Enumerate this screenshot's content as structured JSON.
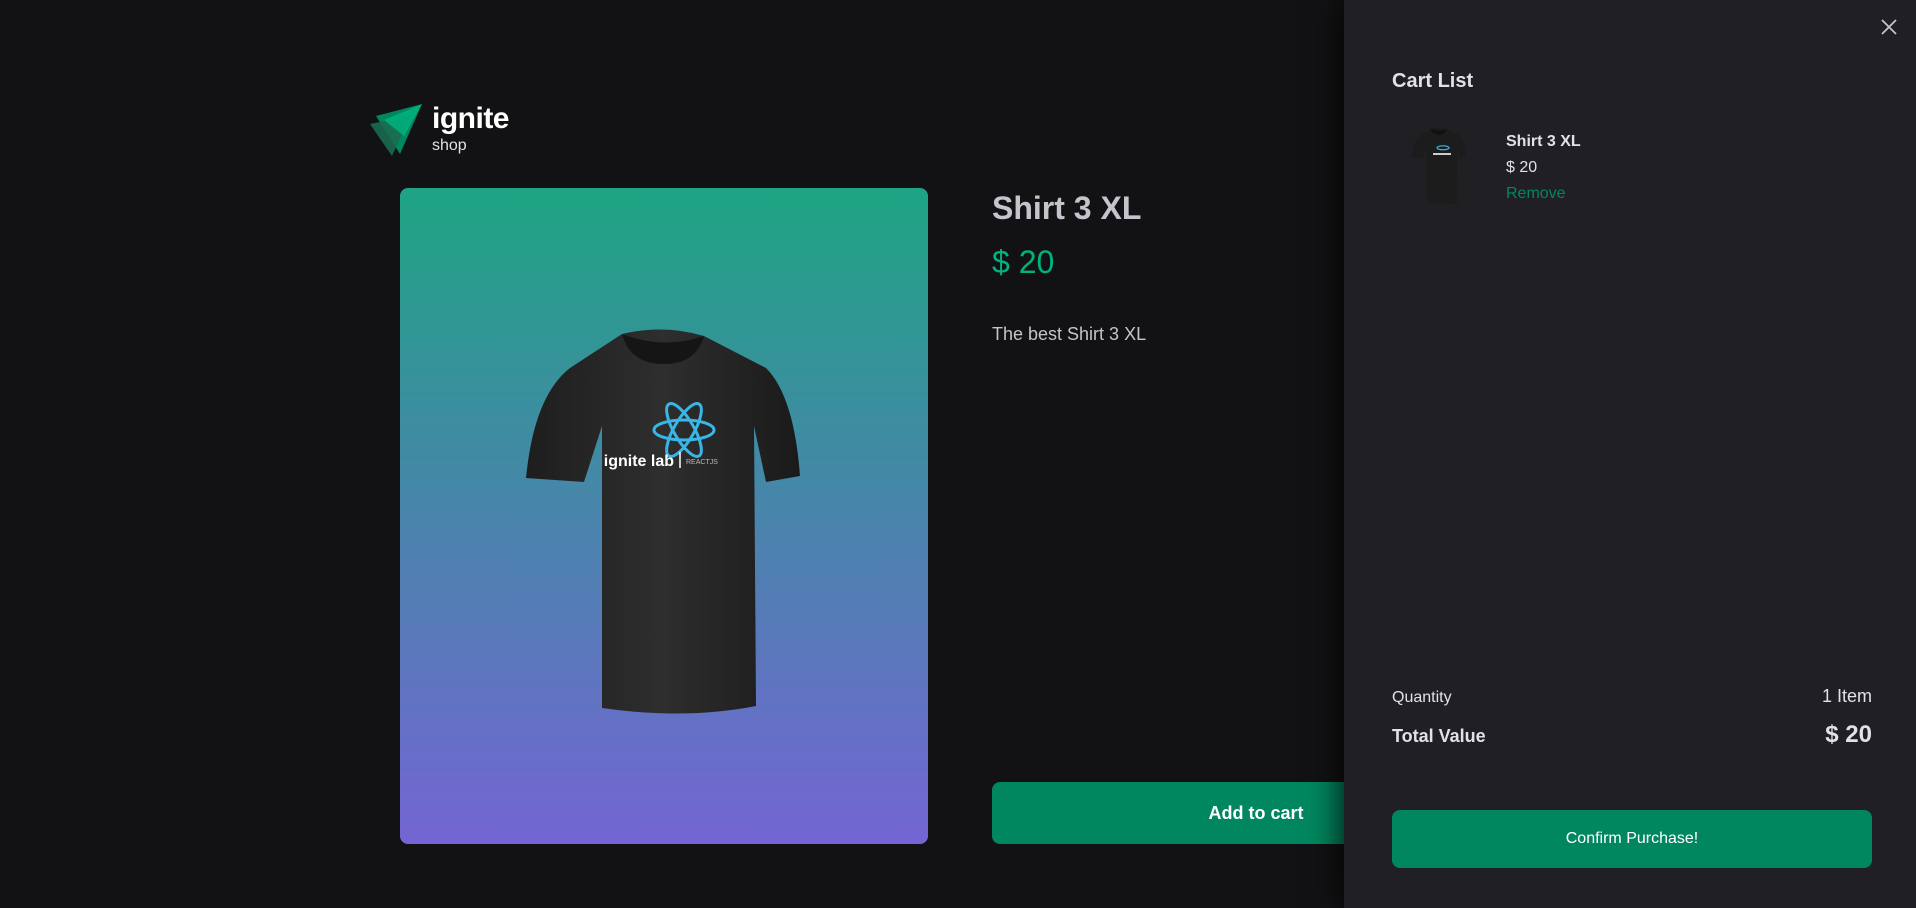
{
  "brand": {
    "name": "ignite",
    "subtitle": "shop"
  },
  "product": {
    "title": "Shirt 3 XL",
    "price": "$ 20",
    "description": "The best Shirt 3 XL",
    "add_to_cart_label": "Add to cart",
    "print_brand": "ignite lab",
    "print_tag": "REACTJS"
  },
  "cart": {
    "title": "Cart List",
    "items": [
      {
        "name": "Shirt 3 XL",
        "price": "$ 20",
        "remove_label": "Remove"
      }
    ],
    "quantity_label": "Quantity",
    "quantity_value": "1 Item",
    "total_label": "Total Value",
    "total_value": "$ 20",
    "confirm_label": "Confirm Purchase!"
  },
  "colors": {
    "background": "#121214",
    "panel": "#202024",
    "accent": "#00875f",
    "price": "#00b37e",
    "gradient_top": "#1ea483",
    "gradient_bottom": "#7465d4"
  },
  "icons": {
    "logo": "ignite-logo-icon",
    "close": "close-icon"
  }
}
